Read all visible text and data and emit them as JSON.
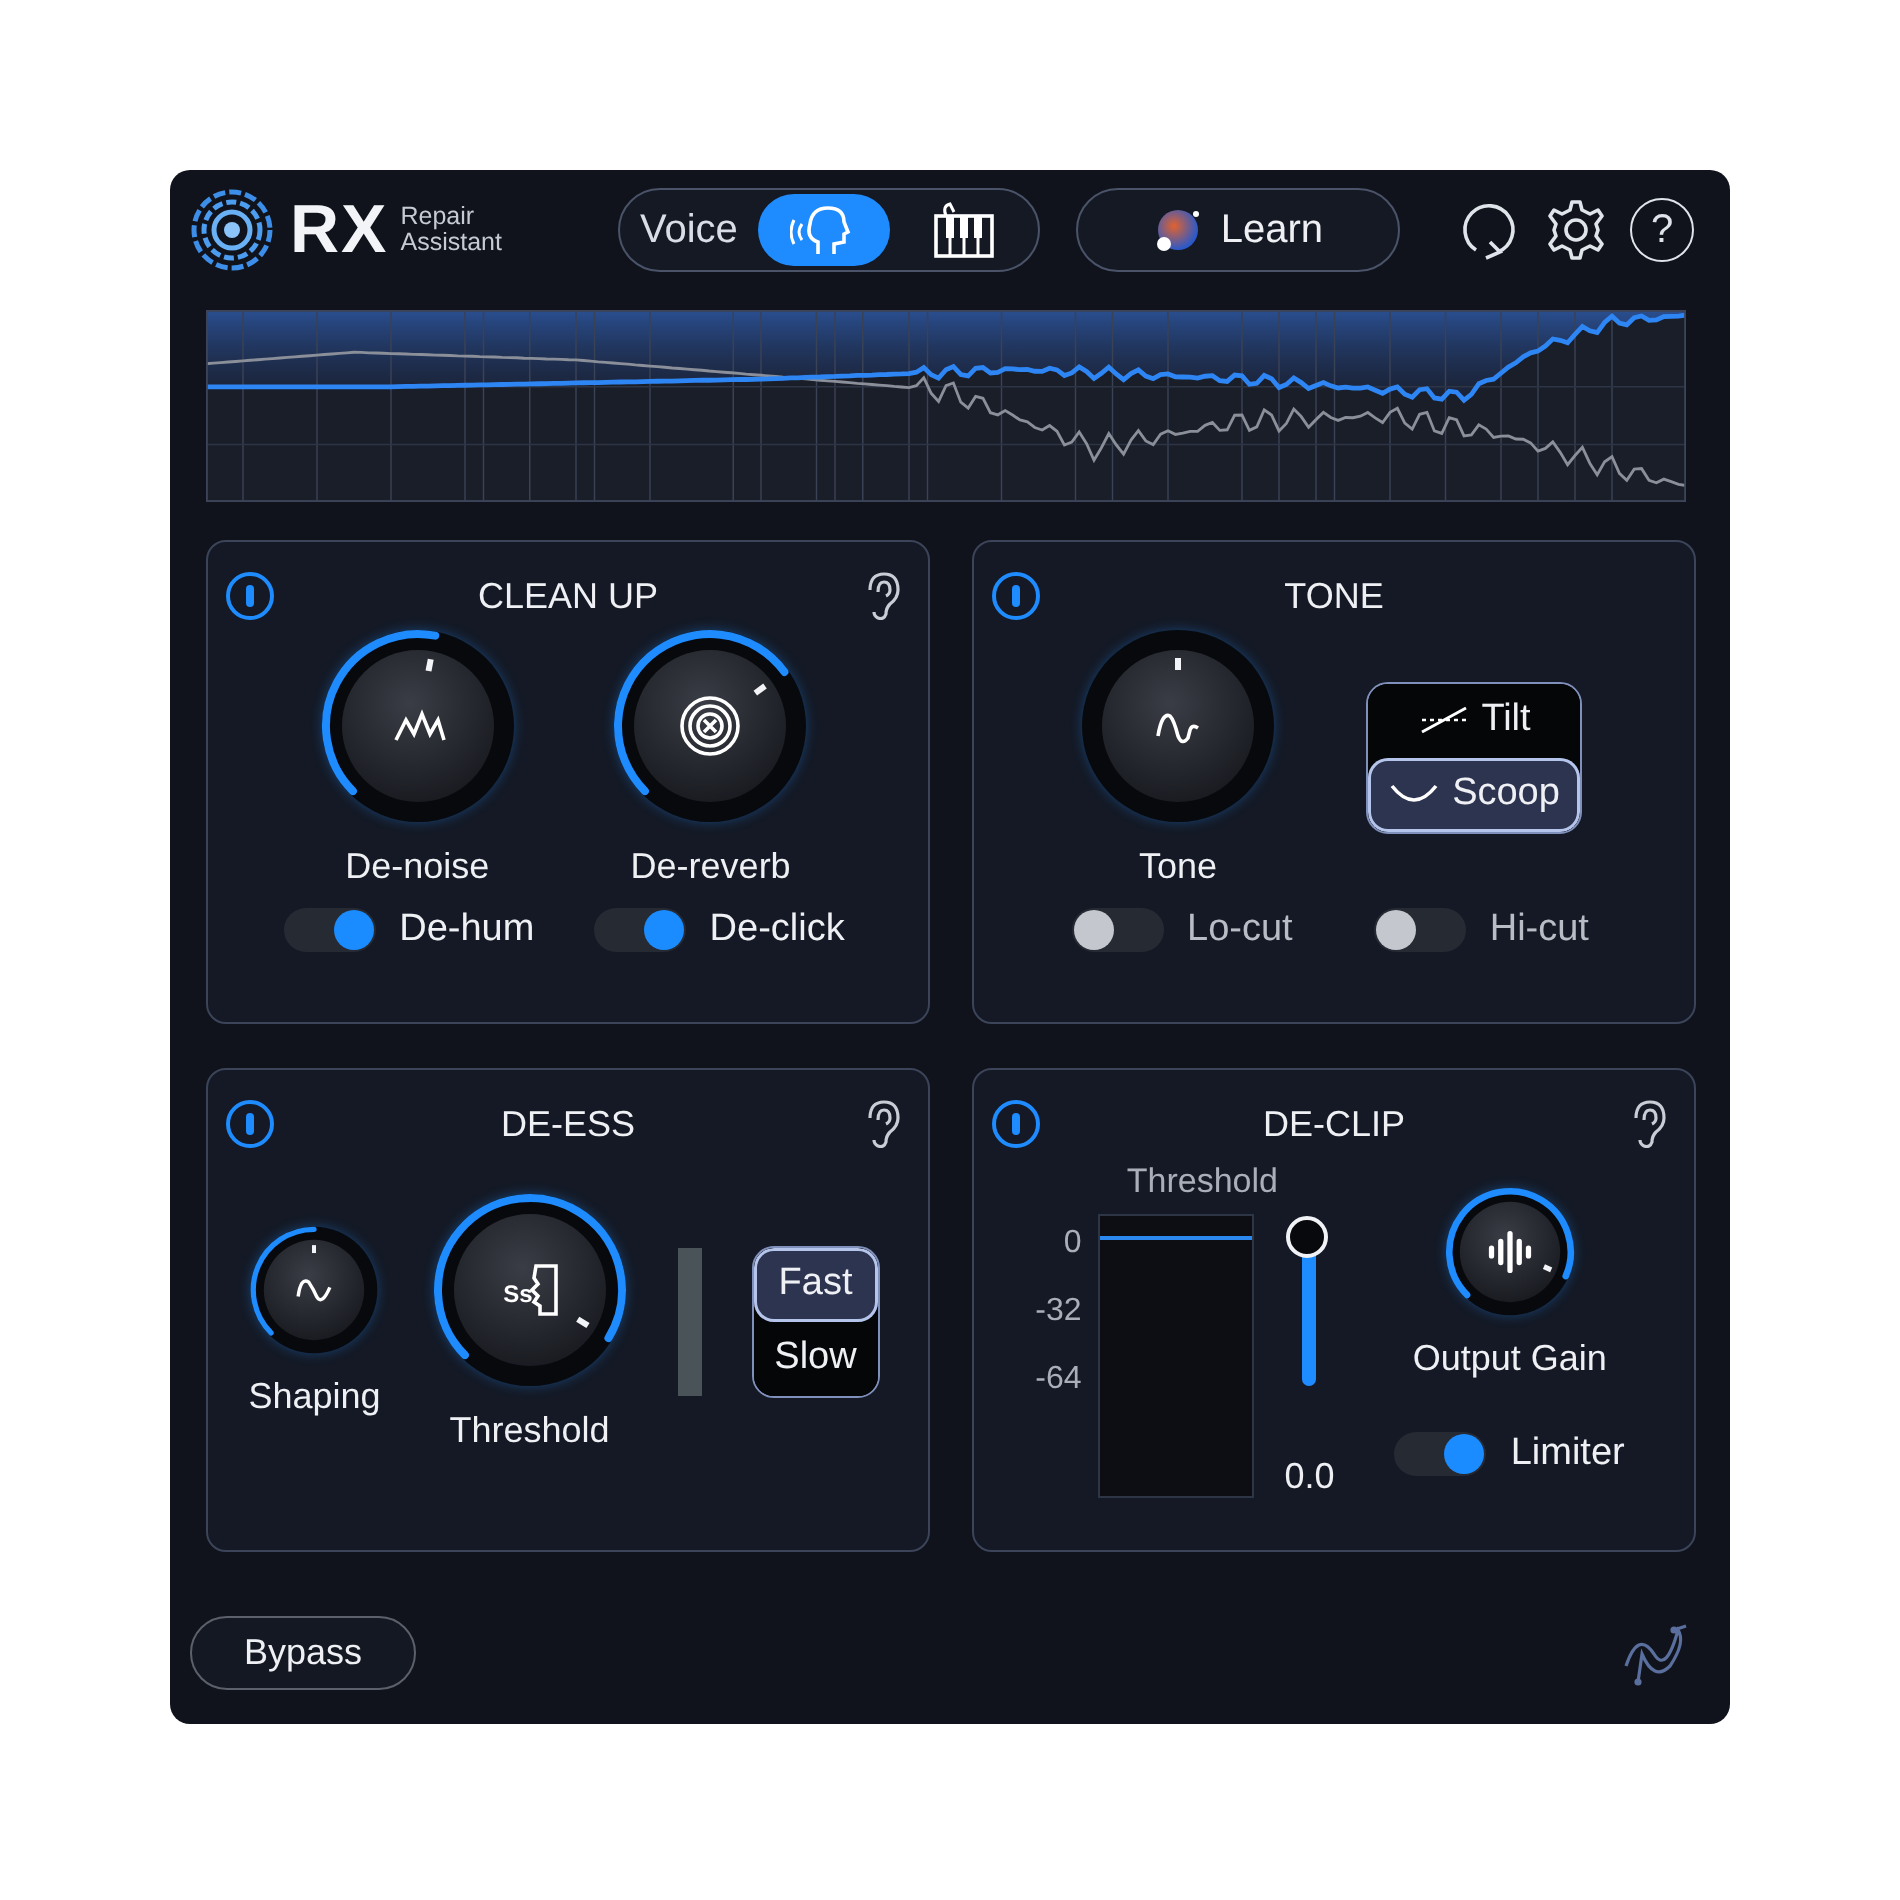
{
  "header": {
    "logo": "RX",
    "product": "Repair Assistant",
    "mode_selector": {
      "label": "Voice",
      "modes": [
        {
          "kind": "voice",
          "selected": true
        },
        {
          "kind": "music",
          "selected": false
        }
      ]
    },
    "learn_button": "Learn",
    "help": "?"
  },
  "modules": [
    {
      "title": "CLEAN UP",
      "enabled": true,
      "listen": true,
      "rows": [
        [
          {
            "kind": "knob",
            "label": "De-noise"
          },
          {
            "kind": "knob",
            "label": "De-reverb"
          }
        ],
        [
          {
            "kind": "toggle",
            "label": "De-hum",
            "on": true
          },
          {
            "kind": "toggle",
            "label": "De-click",
            "on": true
          }
        ]
      ]
    },
    {
      "title": "TONE",
      "enabled": true,
      "listen": false,
      "rows": [
        [
          {
            "kind": "bipolar_knob",
            "label": "Tone"
          },
          {
            "kind": "segmented",
            "options": [
              {
                "label": "Tilt",
                "selected": false
              },
              {
                "label": "Scoop",
                "selected": true
              }
            ]
          }
        ],
        [
          {
            "kind": "toggle",
            "label": "Lo-cut",
            "on": false
          },
          {
            "kind": "toggle",
            "label": "Hi-cut",
            "on": false
          }
        ]
      ]
    },
    {
      "title": "DE-ESS",
      "enabled": true,
      "listen": true,
      "rows": [
        [
          {
            "kind": "small_knob",
            "label": "Shaping"
          },
          {
            "kind": "knob",
            "label": "Threshold",
            "icon_text": "Ss"
          },
          {
            "kind": "meter"
          },
          {
            "kind": "segmented",
            "options": [
              {
                "label": "Fast",
                "selected": true
              },
              {
                "label": "Slow",
                "selected": false
              }
            ]
          }
        ]
      ]
    },
    {
      "title": "DE-CLIP",
      "enabled": true,
      "listen": true,
      "rows": [
        [
          {
            "kind": "threshold",
            "title": "Threshold",
            "scale": [
              "0",
              "-32",
              "-64"
            ],
            "level": 1,
            "reading": "0.0"
          },
          {
            "kind": "stack",
            "items": [
              {
                "kind": "small_knob",
                "label": "Output Gain"
              },
              {
                "kind": "toggle",
                "label": "Limiter",
                "on": true
              }
            ]
          }
        ]
      ]
    }
  ],
  "bypass_button": "Bypass"
}
